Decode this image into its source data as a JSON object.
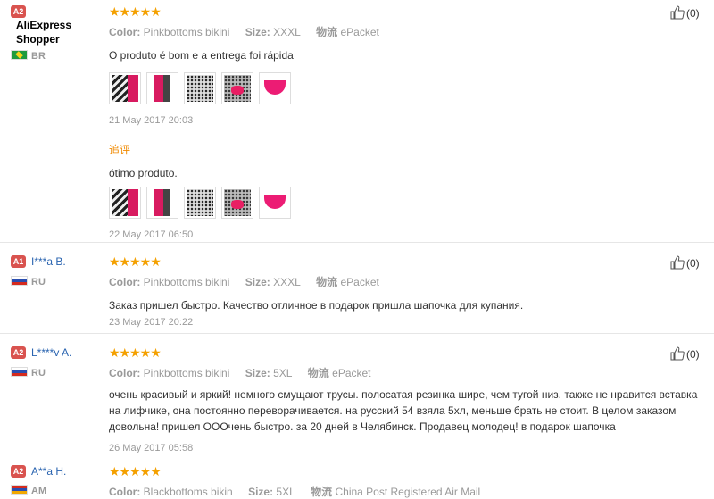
{
  "reviews": [
    {
      "badge": "A2",
      "user": "AliExpress Shopper",
      "country": "BR",
      "stars": "★★★★★",
      "color_label": "Color:",
      "color": "Pinkbottoms bikini",
      "size_label": "Size:",
      "size": "XXXL",
      "shipping_label": "物流",
      "shipping": "ePacket",
      "text": "O produto é bom e a entrega foi rápida",
      "date": "21 May 2017 20:03",
      "append_label": "追评",
      "append_text": "ótimo produto.",
      "append_date": "22 May 2017 06:50",
      "helpful": "(0)"
    },
    {
      "badge": "A1",
      "user": "I***a B.",
      "country": "RU",
      "stars": "★★★★★",
      "color_label": "Color:",
      "color": "Pinkbottoms bikini",
      "size_label": "Size:",
      "size": "XXXL",
      "shipping_label": "物流",
      "shipping": "ePacket",
      "text": "Заказ пришел быстро. Качество отличное в подарок пришла шапочка для купания.",
      "date": "23 May 2017 20:22",
      "helpful": "(0)"
    },
    {
      "badge": "A2",
      "user": "L****v A.",
      "country": "RU",
      "stars": "★★★★★",
      "color_label": "Color:",
      "color": "Pinkbottoms bikini",
      "size_label": "Size:",
      "size": "5XL",
      "shipping_label": "物流",
      "shipping": "ePacket",
      "text": "очень красивый и яркий! немного смущают трусы. полосатая резинка шире, чем тугой низ. также не нравится вставка на лифчике, она постоянно переворачивается. на русский 54 взяла 5хл, меньше брать не стоит. В целом заказом довольна! пришел ООО‌чень быстро. за 20 дней в Челябинск. Продавец молодец! в подарок шапочка",
      "date": "26 May 2017 05:58",
      "helpful": "(0)"
    },
    {
      "badge": "A2",
      "user": "A**a H.",
      "country": "AM",
      "stars": "★★★★★",
      "color_label": "Color:",
      "color": "Blackbottoms bikin",
      "size_label": "Size:",
      "size": "5XL",
      "shipping_label": "物流",
      "shipping": "China Post Registered Air Mail"
    }
  ],
  "icons": {
    "helpful": "thumbs-up-icon"
  },
  "colors": {
    "stars": "#f4a000",
    "badge": "#d9534f",
    "username_link": "#2a64b0",
    "append_label": "#f08a00"
  }
}
